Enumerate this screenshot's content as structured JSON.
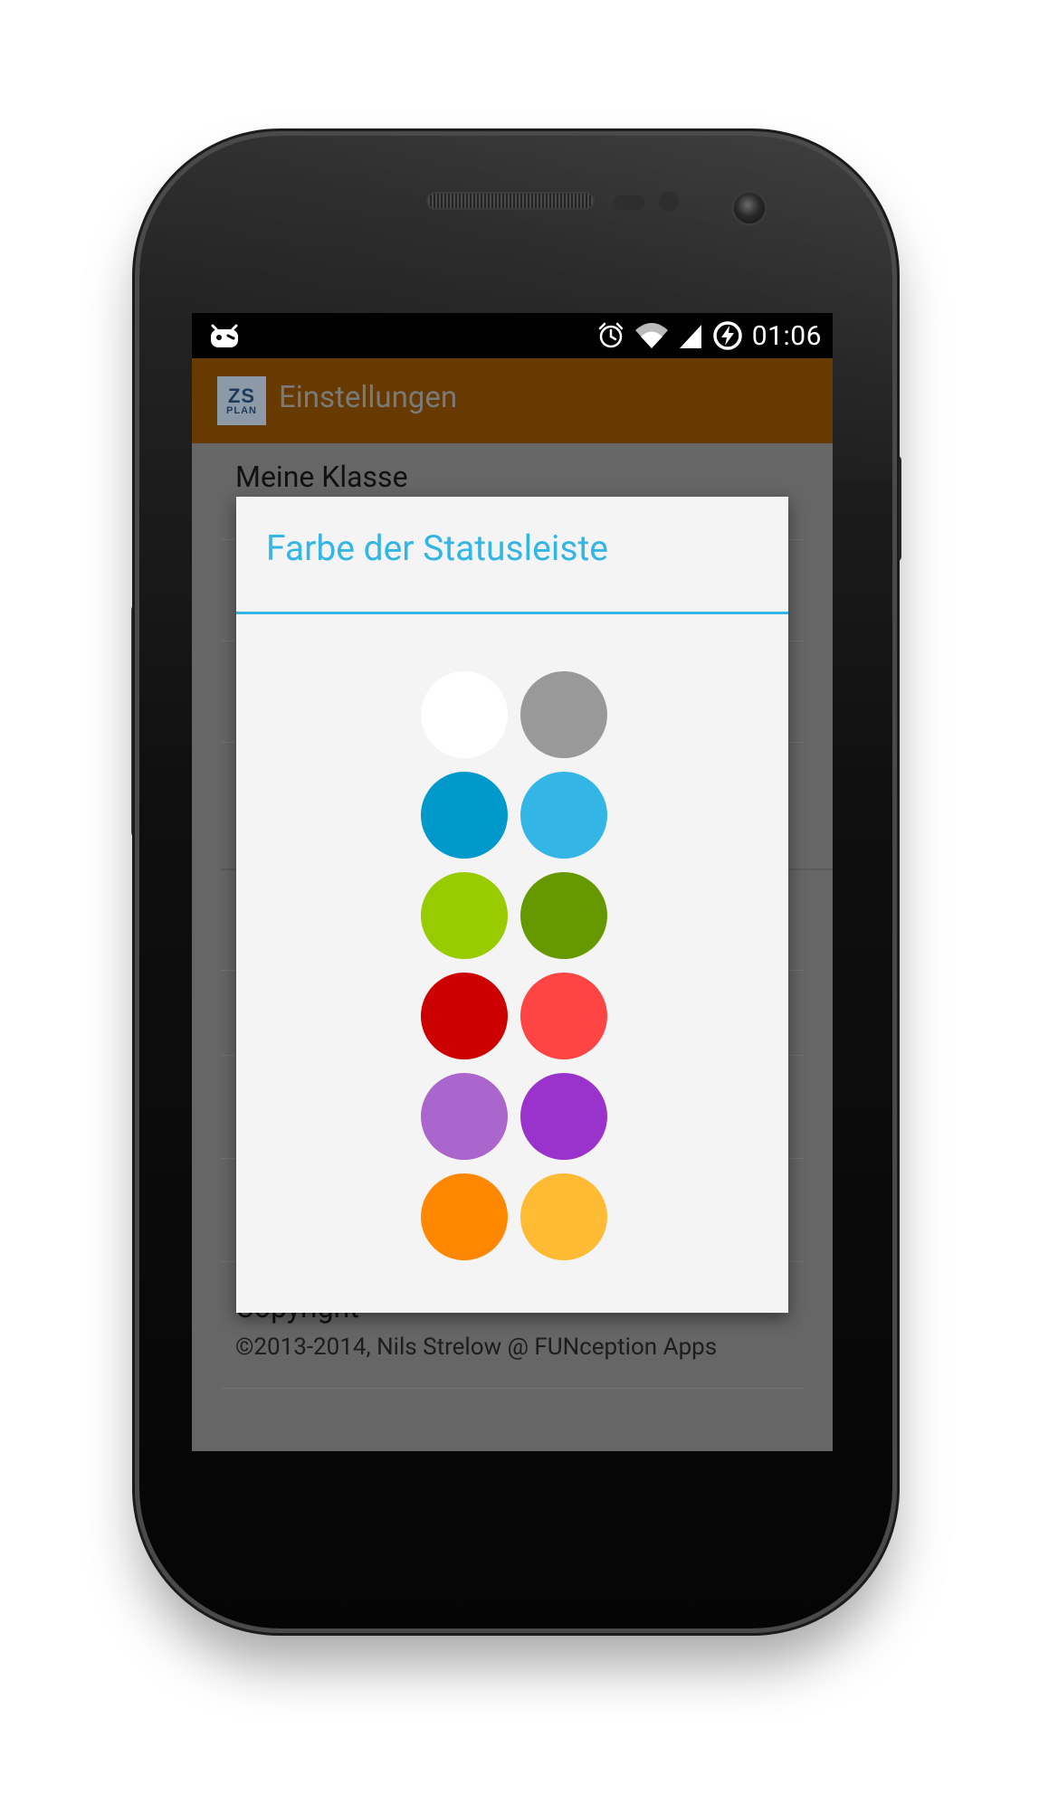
{
  "status_bar": {
    "time": "01:06",
    "icons": [
      "cyanogenmod-icon",
      "alarm-icon",
      "wifi-icon",
      "signal-icon",
      "battery-charging-icon"
    ]
  },
  "action_bar": {
    "logo_line1": "ZS",
    "logo_line2": "PLAN",
    "title": "Einstellungen",
    "color": "#663a00"
  },
  "preferences": {
    "first_item_title": "Meine Klasse",
    "copyright_title": "Copyright",
    "copyright_text": "©2013-2014, Nils Strelow @ FUNception Apps"
  },
  "dialog": {
    "title": "Farbe der Statusleiste",
    "accent_color": "#33b5e5",
    "swatches": [
      {
        "name": "white",
        "color": "#ffffff"
      },
      {
        "name": "gray",
        "color": "#999999"
      },
      {
        "name": "dark-blue",
        "color": "#0099cc"
      },
      {
        "name": "light-blue",
        "color": "#33b5e5"
      },
      {
        "name": "light-green",
        "color": "#99cc00"
      },
      {
        "name": "dark-green",
        "color": "#669900"
      },
      {
        "name": "dark-red",
        "color": "#cc0000"
      },
      {
        "name": "light-red",
        "color": "#ff4444"
      },
      {
        "name": "light-purple",
        "color": "#aa66cc"
      },
      {
        "name": "dark-purple",
        "color": "#9933cc"
      },
      {
        "name": "dark-orange",
        "color": "#ff8800"
      },
      {
        "name": "light-orange",
        "color": "#ffbb33"
      }
    ]
  }
}
